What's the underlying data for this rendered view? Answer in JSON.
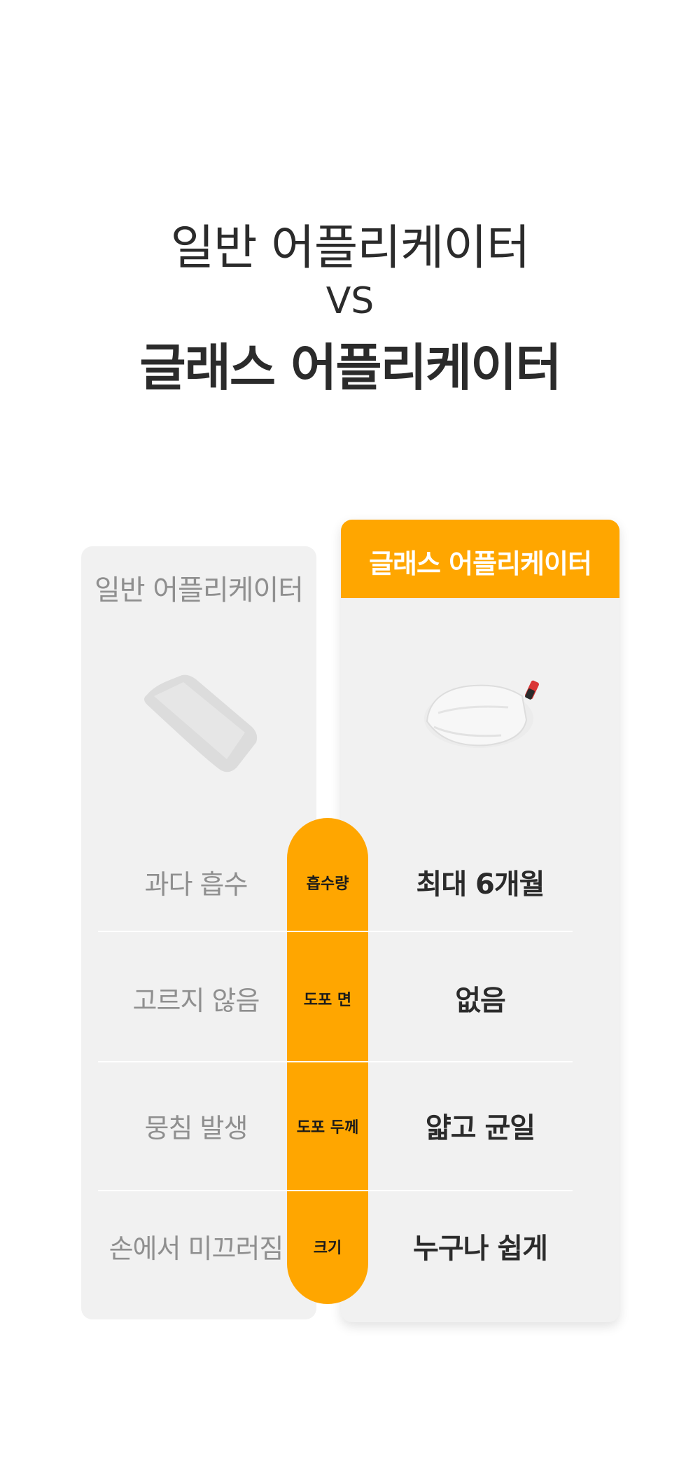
{
  "heading": {
    "line1": "일반 어플리케이터",
    "vs": "VS",
    "line3": "글래스 어플리케이터"
  },
  "left_card": {
    "title": "일반 어플리케이터",
    "image": "flat-sponge-pad"
  },
  "right_card": {
    "title": "글래스 어플리케이터",
    "image": "microfiber-mitt",
    "accent_color": "#ffa600"
  },
  "rows": [
    {
      "left": "과다 흡수",
      "label": "흡수량",
      "right": "최대 6개월"
    },
    {
      "left": "고르지 않음",
      "label": "도포 면",
      "right": "없음"
    },
    {
      "left": "뭉침 발생",
      "label": "도포 두께",
      "right": "얇고 균일"
    },
    {
      "left": "손에서 미끄러짐",
      "label": "크기",
      "right": "누구나 쉽게"
    }
  ]
}
